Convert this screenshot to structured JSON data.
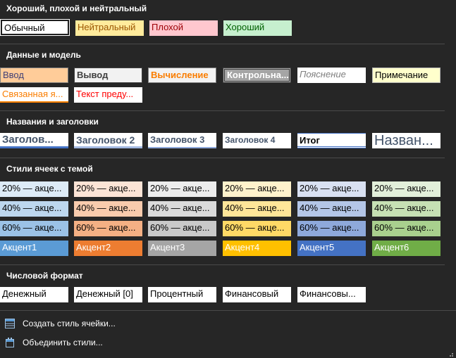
{
  "sections": {
    "good_bad": {
      "title": "Хороший, плохой и нейтральный",
      "cells": [
        "Обычный",
        "Нейтральный",
        "Плохой",
        "Хороший"
      ]
    },
    "data_model": {
      "title": "Данные и модель",
      "row1": [
        "Ввод",
        "Вывод",
        "Вычисление",
        "Контрольна...",
        "Пояснение",
        "Примечание"
      ],
      "row2": [
        "Связанная я...",
        "Текст преду..."
      ]
    },
    "headings": {
      "title": "Названия и заголовки",
      "cells": [
        "Заголов...",
        "Заголовок 2",
        "Заголовок 3",
        "Заголовок 4",
        "Итог",
        "Назван..."
      ]
    },
    "theme": {
      "title": "Стили ячеек с темой",
      "row20": [
        "20% — акце...",
        "20% — акце...",
        "20% — акце...",
        "20% — акце...",
        "20% — акце...",
        "20% — акце..."
      ],
      "row40": [
        "40% — акце...",
        "40% — акце...",
        "40% — акце...",
        "40% — акце...",
        "40% — акце...",
        "40% — акце..."
      ],
      "row60": [
        "60% — акце...",
        "60% — акце...",
        "60% — акце...",
        "60% — акце...",
        "60% — акце...",
        "60% — акце..."
      ],
      "accents": [
        "Акцент1",
        "Акцент2",
        "Акцент3",
        "Акцент4",
        "Акцент5",
        "Акцент6"
      ]
    },
    "number": {
      "title": "Числовой формат",
      "cells": [
        "Денежный",
        "Денежный [0]",
        "Процентный",
        "Финансовый",
        "Финансовы..."
      ]
    }
  },
  "footer": {
    "create_style": "Создать стиль ячейки...",
    "merge_styles": "Объединить стили..."
  },
  "colors": {
    "background": "#262626",
    "neutral_bg": "#ffeb9c",
    "neutral_fg": "#9c5700",
    "bad_bg": "#ffc7ce",
    "bad_fg": "#9c0006",
    "good_bg": "#c6efce",
    "good_fg": "#006100",
    "input_bg": "#ffcc99",
    "calc_fg": "#fa7d00",
    "accent1": "#5b9bd5",
    "accent2": "#ed7d31",
    "accent3": "#a5a5a5",
    "accent4": "#ffc000",
    "accent5": "#4472c4",
    "accent6": "#70ad47"
  },
  "icons": [
    "create-cell-style-icon",
    "merge-styles-icon"
  ]
}
